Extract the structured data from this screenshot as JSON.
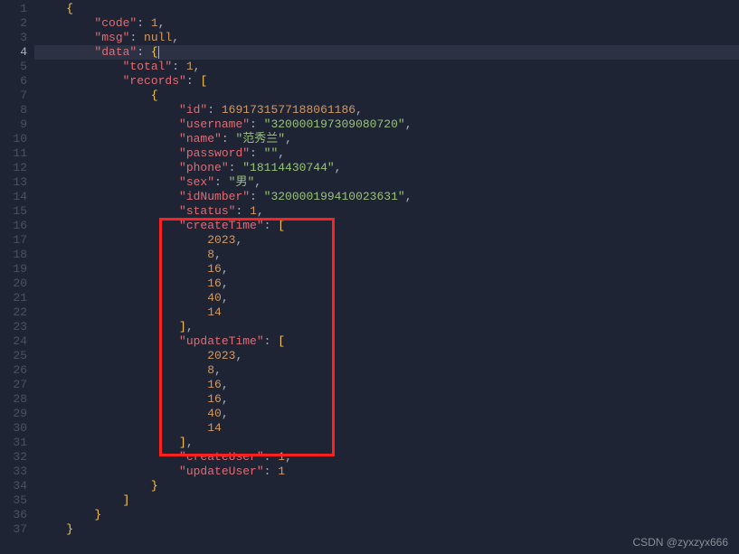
{
  "watermark": "CSDN @zyxzyx666",
  "lines": [
    {
      "num": "1",
      "indent": 1,
      "tokens": [
        {
          "t": "p",
          "v": "{"
        }
      ]
    },
    {
      "num": "2",
      "indent": 2,
      "tokens": [
        {
          "t": "k",
          "v": "\"code\""
        },
        {
          "t": "c",
          "v": ": "
        },
        {
          "t": "n",
          "v": "1"
        },
        {
          "t": "c",
          "v": ","
        }
      ]
    },
    {
      "num": "3",
      "indent": 2,
      "tokens": [
        {
          "t": "k",
          "v": "\"msg\""
        },
        {
          "t": "c",
          "v": ": "
        },
        {
          "t": "nl",
          "v": "null"
        },
        {
          "t": "c",
          "v": ","
        }
      ]
    },
    {
      "num": "4",
      "indent": 2,
      "current": true,
      "tokens": [
        {
          "t": "k",
          "v": "\"data\""
        },
        {
          "t": "c",
          "v": ": "
        },
        {
          "t": "p",
          "v": "{"
        },
        {
          "t": "cursor",
          "v": ""
        }
      ]
    },
    {
      "num": "5",
      "indent": 3,
      "tokens": [
        {
          "t": "k",
          "v": "\"total\""
        },
        {
          "t": "c",
          "v": ": "
        },
        {
          "t": "n",
          "v": "1"
        },
        {
          "t": "c",
          "v": ","
        }
      ]
    },
    {
      "num": "6",
      "indent": 3,
      "tokens": [
        {
          "t": "k",
          "v": "\"records\""
        },
        {
          "t": "c",
          "v": ": "
        },
        {
          "t": "p",
          "v": "["
        }
      ]
    },
    {
      "num": "7",
      "indent": 4,
      "tokens": [
        {
          "t": "p",
          "v": "{"
        }
      ]
    },
    {
      "num": "8",
      "indent": 5,
      "tokens": [
        {
          "t": "k",
          "v": "\"id\""
        },
        {
          "t": "c",
          "v": ": "
        },
        {
          "t": "n",
          "v": "1691731577188061186"
        },
        {
          "t": "c",
          "v": ","
        }
      ]
    },
    {
      "num": "9",
      "indent": 5,
      "tokens": [
        {
          "t": "k",
          "v": "\"username\""
        },
        {
          "t": "c",
          "v": ": "
        },
        {
          "t": "s",
          "v": "\"320000197309080720\""
        },
        {
          "t": "c",
          "v": ","
        }
      ]
    },
    {
      "num": "10",
      "indent": 5,
      "tokens": [
        {
          "t": "k",
          "v": "\"name\""
        },
        {
          "t": "c",
          "v": ": "
        },
        {
          "t": "s",
          "v": "\"范秀兰\""
        },
        {
          "t": "c",
          "v": ","
        }
      ]
    },
    {
      "num": "11",
      "indent": 5,
      "tokens": [
        {
          "t": "k",
          "v": "\"password\""
        },
        {
          "t": "c",
          "v": ": "
        },
        {
          "t": "s",
          "v": "\"\""
        },
        {
          "t": "c",
          "v": ","
        }
      ]
    },
    {
      "num": "12",
      "indent": 5,
      "tokens": [
        {
          "t": "k",
          "v": "\"phone\""
        },
        {
          "t": "c",
          "v": ": "
        },
        {
          "t": "s",
          "v": "\"18114430744\""
        },
        {
          "t": "c",
          "v": ","
        }
      ]
    },
    {
      "num": "13",
      "indent": 5,
      "tokens": [
        {
          "t": "k",
          "v": "\"sex\""
        },
        {
          "t": "c",
          "v": ": "
        },
        {
          "t": "s",
          "v": "\"男\""
        },
        {
          "t": "c",
          "v": ","
        }
      ]
    },
    {
      "num": "14",
      "indent": 5,
      "tokens": [
        {
          "t": "k",
          "v": "\"idNumber\""
        },
        {
          "t": "c",
          "v": ": "
        },
        {
          "t": "s",
          "v": "\"320000199410023631\""
        },
        {
          "t": "c",
          "v": ","
        }
      ]
    },
    {
      "num": "15",
      "indent": 5,
      "tokens": [
        {
          "t": "k",
          "v": "\"status\""
        },
        {
          "t": "c",
          "v": ": "
        },
        {
          "t": "n",
          "v": "1"
        },
        {
          "t": "c",
          "v": ","
        }
      ]
    },
    {
      "num": "16",
      "indent": 5,
      "tokens": [
        {
          "t": "k",
          "v": "\"createTime\""
        },
        {
          "t": "c",
          "v": ": "
        },
        {
          "t": "p",
          "v": "["
        }
      ]
    },
    {
      "num": "17",
      "indent": 6,
      "tokens": [
        {
          "t": "n",
          "v": "2023"
        },
        {
          "t": "c",
          "v": ","
        }
      ]
    },
    {
      "num": "18",
      "indent": 6,
      "tokens": [
        {
          "t": "n",
          "v": "8"
        },
        {
          "t": "c",
          "v": ","
        }
      ]
    },
    {
      "num": "19",
      "indent": 6,
      "tokens": [
        {
          "t": "n",
          "v": "16"
        },
        {
          "t": "c",
          "v": ","
        }
      ]
    },
    {
      "num": "20",
      "indent": 6,
      "tokens": [
        {
          "t": "n",
          "v": "16"
        },
        {
          "t": "c",
          "v": ","
        }
      ]
    },
    {
      "num": "21",
      "indent": 6,
      "tokens": [
        {
          "t": "n",
          "v": "40"
        },
        {
          "t": "c",
          "v": ","
        }
      ]
    },
    {
      "num": "22",
      "indent": 6,
      "tokens": [
        {
          "t": "n",
          "v": "14"
        }
      ]
    },
    {
      "num": "23",
      "indent": 5,
      "tokens": [
        {
          "t": "p",
          "v": "]"
        },
        {
          "t": "c",
          "v": ","
        }
      ]
    },
    {
      "num": "24",
      "indent": 5,
      "tokens": [
        {
          "t": "k",
          "v": "\"updateTime\""
        },
        {
          "t": "c",
          "v": ": "
        },
        {
          "t": "p",
          "v": "["
        }
      ]
    },
    {
      "num": "25",
      "indent": 6,
      "tokens": [
        {
          "t": "n",
          "v": "2023"
        },
        {
          "t": "c",
          "v": ","
        }
      ]
    },
    {
      "num": "26",
      "indent": 6,
      "tokens": [
        {
          "t": "n",
          "v": "8"
        },
        {
          "t": "c",
          "v": ","
        }
      ]
    },
    {
      "num": "27",
      "indent": 6,
      "tokens": [
        {
          "t": "n",
          "v": "16"
        },
        {
          "t": "c",
          "v": ","
        }
      ]
    },
    {
      "num": "28",
      "indent": 6,
      "tokens": [
        {
          "t": "n",
          "v": "16"
        },
        {
          "t": "c",
          "v": ","
        }
      ]
    },
    {
      "num": "29",
      "indent": 6,
      "tokens": [
        {
          "t": "n",
          "v": "40"
        },
        {
          "t": "c",
          "v": ","
        }
      ]
    },
    {
      "num": "30",
      "indent": 6,
      "tokens": [
        {
          "t": "n",
          "v": "14"
        }
      ]
    },
    {
      "num": "31",
      "indent": 5,
      "tokens": [
        {
          "t": "p",
          "v": "]"
        },
        {
          "t": "c",
          "v": ","
        }
      ]
    },
    {
      "num": "32",
      "indent": 5,
      "tokens": [
        {
          "t": "k",
          "v": "\"createUser\""
        },
        {
          "t": "c",
          "v": ": "
        },
        {
          "t": "n",
          "v": "1"
        },
        {
          "t": "c",
          "v": ","
        }
      ]
    },
    {
      "num": "33",
      "indent": 5,
      "tokens": [
        {
          "t": "k",
          "v": "\"updateUser\""
        },
        {
          "t": "c",
          "v": ": "
        },
        {
          "t": "n",
          "v": "1"
        }
      ]
    },
    {
      "num": "34",
      "indent": 4,
      "tokens": [
        {
          "t": "p",
          "v": "}"
        }
      ]
    },
    {
      "num": "35",
      "indent": 3,
      "tokens": [
        {
          "t": "p",
          "v": "]"
        }
      ]
    },
    {
      "num": "36",
      "indent": 2,
      "tokens": [
        {
          "t": "p",
          "v": "}"
        }
      ]
    },
    {
      "num": "37",
      "indent": 1,
      "tokens": [
        {
          "t": "p",
          "v": "}"
        }
      ]
    }
  ]
}
